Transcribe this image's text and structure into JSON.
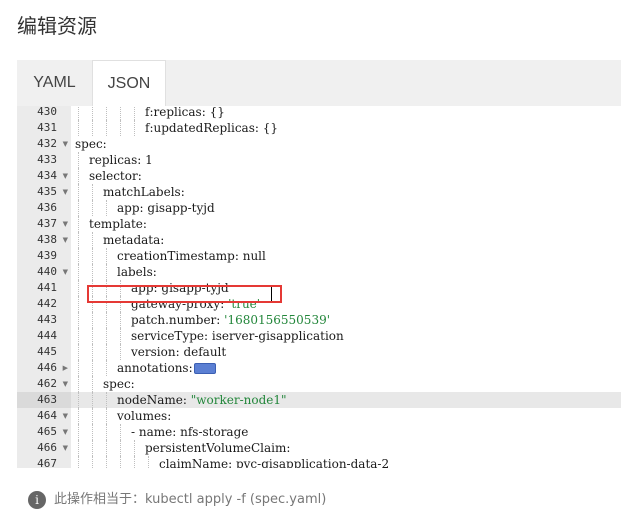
{
  "page": {
    "title": "编辑资源"
  },
  "tabs": [
    {
      "label": "YAML",
      "active": false
    },
    {
      "label": "JSON",
      "active": true
    }
  ],
  "editor": {
    "highlighted_line": "463",
    "lines": [
      {
        "num": "430",
        "indent": 5,
        "fold": false,
        "key": "f:replicas",
        "value": "{}",
        "vtype": "plain"
      },
      {
        "num": "431",
        "indent": 5,
        "fold": false,
        "key": "f:updatedReplicas",
        "value": "{}",
        "vtype": "plain"
      },
      {
        "num": "432",
        "indent": 0,
        "fold": true,
        "key": "spec",
        "value": "",
        "vtype": "plain"
      },
      {
        "num": "433",
        "indent": 1,
        "fold": false,
        "key": "replicas",
        "value": "1",
        "vtype": "plain"
      },
      {
        "num": "434",
        "indent": 1,
        "fold": true,
        "key": "selector",
        "value": "",
        "vtype": "plain"
      },
      {
        "num": "435",
        "indent": 2,
        "fold": true,
        "key": "matchLabels",
        "value": "",
        "vtype": "plain"
      },
      {
        "num": "436",
        "indent": 3,
        "fold": false,
        "key": "app",
        "value": "gisapp-tyjd",
        "vtype": "plain"
      },
      {
        "num": "437",
        "indent": 1,
        "fold": true,
        "key": "template",
        "value": "",
        "vtype": "plain"
      },
      {
        "num": "438",
        "indent": 2,
        "fold": true,
        "key": "metadata",
        "value": "",
        "vtype": "plain"
      },
      {
        "num": "439",
        "indent": 3,
        "fold": false,
        "key": "creationTimestamp",
        "value": "null",
        "vtype": "plain"
      },
      {
        "num": "440",
        "indent": 3,
        "fold": true,
        "key": "labels",
        "value": "",
        "vtype": "plain"
      },
      {
        "num": "441",
        "indent": 4,
        "fold": false,
        "key": "app",
        "value": "gisapp-tyjd",
        "vtype": "plain"
      },
      {
        "num": "442",
        "indent": 4,
        "fold": false,
        "key": "gateway-proxy",
        "value": "'true'",
        "vtype": "str"
      },
      {
        "num": "443",
        "indent": 4,
        "fold": false,
        "key": "patch.number",
        "value": "'1680156550539'",
        "vtype": "str"
      },
      {
        "num": "444",
        "indent": 4,
        "fold": false,
        "key": "serviceType",
        "value": "iserver-gisapplication",
        "vtype": "plain"
      },
      {
        "num": "445",
        "indent": 4,
        "fold": false,
        "key": "version",
        "value": "default",
        "vtype": "plain"
      },
      {
        "num": "446",
        "indent": 3,
        "fold": "collapsed",
        "key": "annotations",
        "value": "",
        "vtype": "anno"
      },
      {
        "num": "462",
        "indent": 2,
        "fold": true,
        "key": "spec",
        "value": "",
        "vtype": "plain"
      },
      {
        "num": "463",
        "indent": 3,
        "fold": false,
        "key": "nodeName",
        "value": "\"worker-node1\"",
        "vtype": "str"
      },
      {
        "num": "464",
        "indent": 3,
        "fold": true,
        "key": "volumes",
        "value": "",
        "vtype": "plain"
      },
      {
        "num": "465",
        "indent": 4,
        "fold": true,
        "key": "- name",
        "value": "nfs-storage",
        "vtype": "plain"
      },
      {
        "num": "466",
        "indent": 5,
        "fold": true,
        "key": "persistentVolumeClaim",
        "value": "",
        "vtype": "plain"
      },
      {
        "num": "467",
        "indent": 6,
        "fold": false,
        "key": "claimName",
        "value": "pvc-gisapplication-data-2",
        "vtype": "plain"
      }
    ]
  },
  "footer": {
    "note": "此操作相当于：kubectl apply -f (spec.yaml)"
  },
  "icons": {
    "info": "info-icon",
    "fold": "chevron-icon",
    "annotations": "collapsed-annotations-icon"
  }
}
